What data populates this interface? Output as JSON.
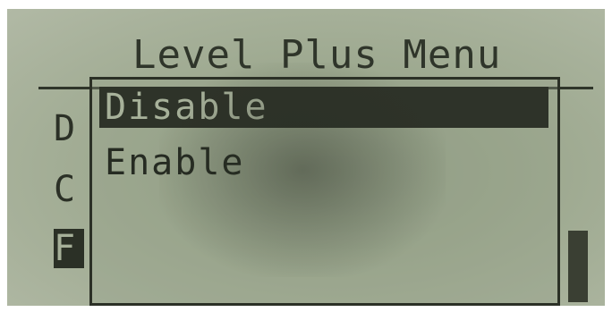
{
  "screen": {
    "title": "Level Plus Menu"
  },
  "background_menu": {
    "items": [
      "D",
      "C",
      "F"
    ],
    "selected_index": 2
  },
  "popup": {
    "options": [
      {
        "label": "Disable",
        "selected": true
      },
      {
        "label": "Enable",
        "selected": false
      }
    ]
  },
  "colors": {
    "lcd_background": "#a6b099",
    "lcd_ink": "#2b3026"
  }
}
